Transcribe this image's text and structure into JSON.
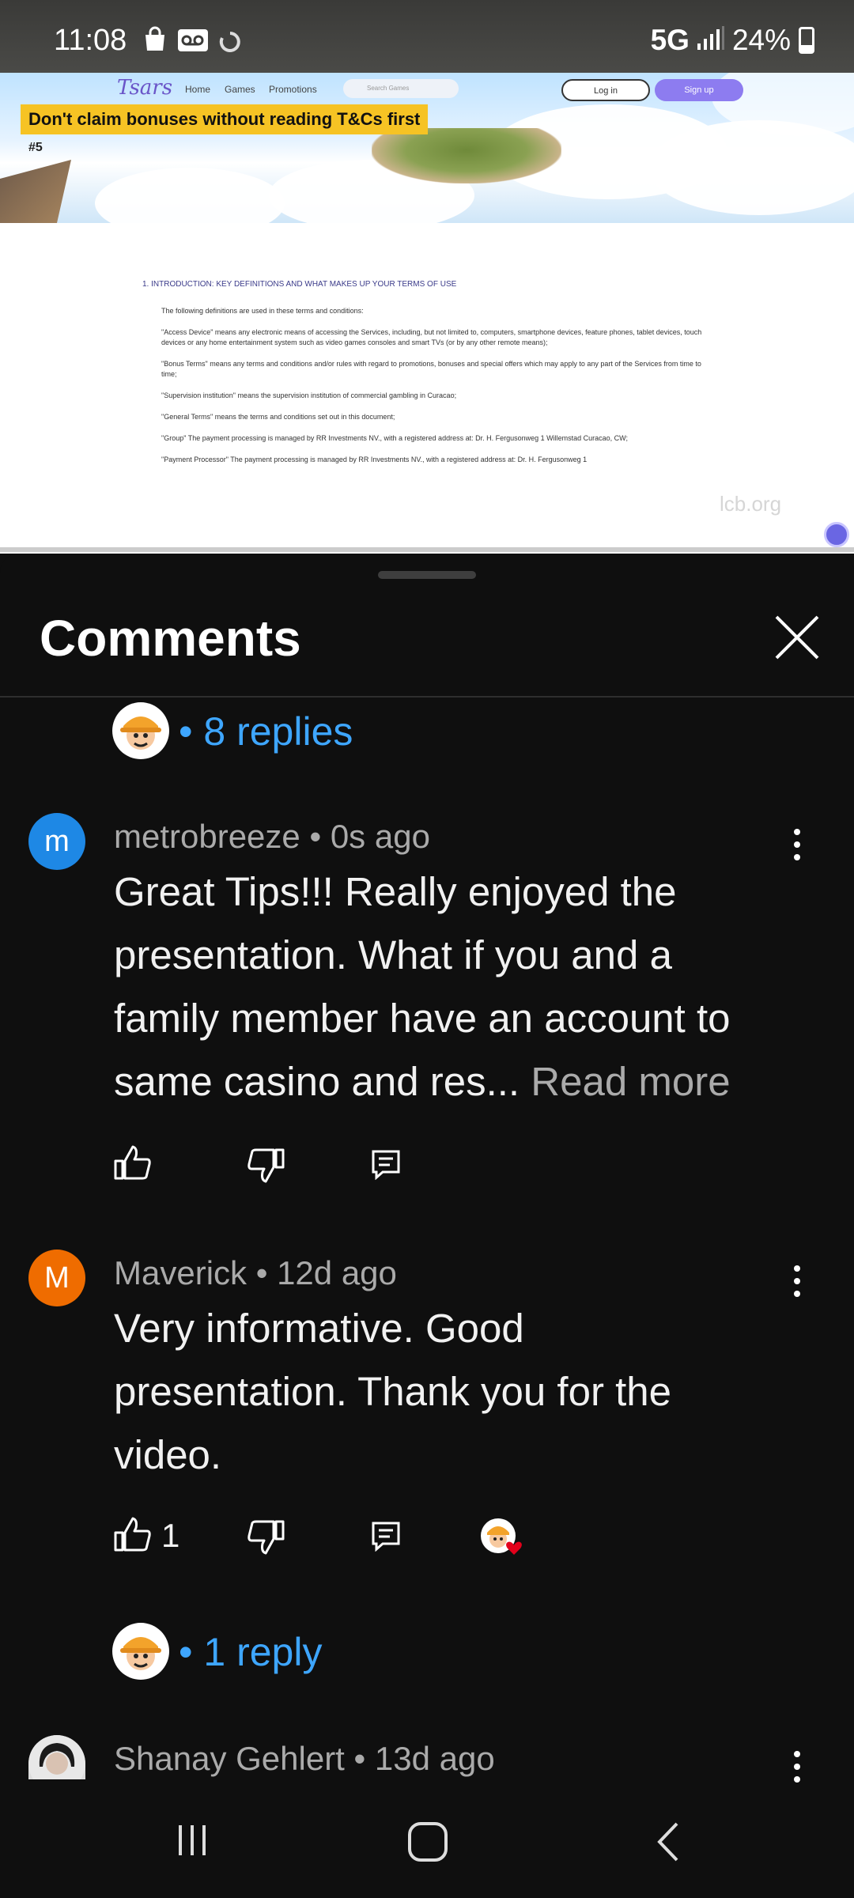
{
  "status_bar": {
    "time": "11:08",
    "network": "5G",
    "battery": "24%"
  },
  "video": {
    "site_logo": "Tsars",
    "nav": [
      "Home",
      "Games",
      "Promotions"
    ],
    "search_placeholder": "Search Games",
    "login_label": "Log in",
    "signup_label": "Sign up",
    "banner": "Don't claim bonuses without reading T&Cs first",
    "badge": "#5",
    "doc_heading": "1. INTRODUCTION: KEY DEFINITIONS AND WHAT MAKES UP YOUR TERMS OF USE",
    "doc_paragraphs": [
      "The following definitions are used in these terms and conditions:",
      "\"Access Device\" means any electronic means of accessing the Services, including, but not limited to, computers, smartphone devices, feature phones, tablet devices, touch devices or any home entertainment system such as video games consoles and smart TVs (or by any other remote means);",
      "\"Bonus Terms\" means any terms and conditions and/or rules with regard to promotions, bonuses and special offers which may apply to any part of the Services from time to time;",
      "\"Supervision institution\" means the supervision institution of commercial gambling in Curacao;",
      "\"General Terms\" means the terms and conditions set out in this document;",
      "\"Group\" The payment processing is managed by RR Investments NV., with a registered address at: Dr. H. Fergusonweg 1 Willemstad Curacao, CW;",
      "\"Payment Processor\" The payment processing is managed by RR Investments NV., with a registered address at: Dr. H. Fergusonweg 1"
    ],
    "watermark": "lcb.org"
  },
  "comments_sheet": {
    "title": "Comments",
    "top_replies": "• 8 replies",
    "comments": [
      {
        "avatar_letter": "m",
        "avatar_color": "#1e88e5",
        "author": "metrobreeze",
        "time": "• 0s ago",
        "lines": [
          "Great Tips!!!  Really enjoyed the",
          "presentation.  What if you and a",
          "family member have an account to",
          "same casino and res... "
        ],
        "read_more": "Read more"
      },
      {
        "avatar_letter": "M",
        "avatar_color": "#ef6c00",
        "author": "Maverick",
        "time": "• 12d ago",
        "lines": [
          "Very informative. Good",
          "presentation. Thank you for the",
          "video."
        ],
        "likes": "1",
        "replies": "• 1 reply"
      },
      {
        "author": "Shanay Gehlert",
        "time": "• 13d ago"
      }
    ]
  }
}
